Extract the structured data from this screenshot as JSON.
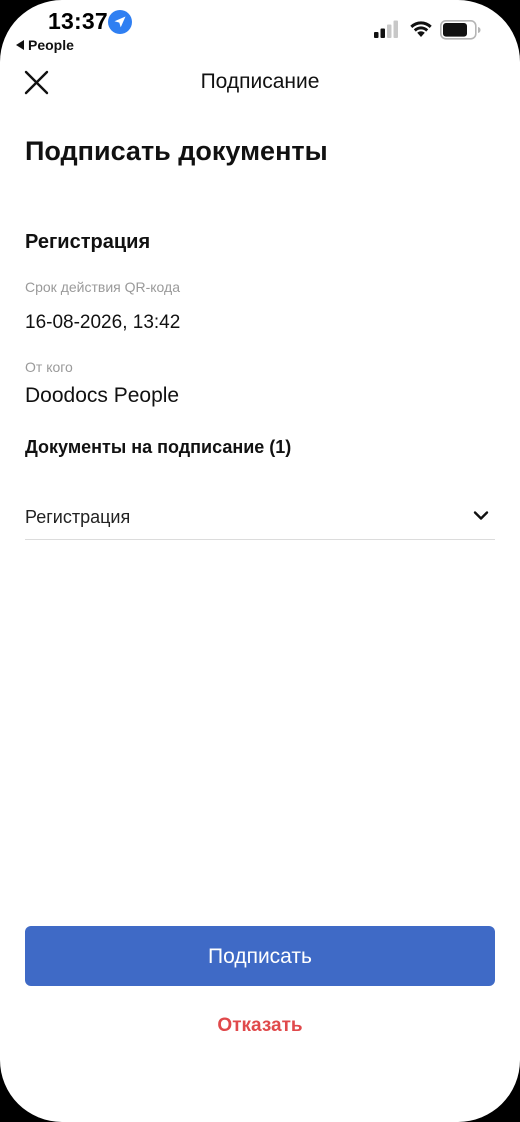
{
  "status_bar": {
    "time": "13:37",
    "back_app": "People",
    "location_icon": "location-arrow-icon",
    "signal_icon": "cellular-signal-icon",
    "wifi_icon": "wifi-icon",
    "battery_icon": "battery-icon"
  },
  "nav": {
    "title": "Подписание",
    "close_icon": "close-icon"
  },
  "page": {
    "title": "Подписать документы",
    "section_title": "Регистрация",
    "fields": [
      {
        "label": "Срок действия QR-кода",
        "value": "16-08-2026, 13:42"
      },
      {
        "label": "От кого",
        "value": "Doodocs People"
      }
    ],
    "documents_title": "Документы на подписание (1)",
    "documents": [
      {
        "name": "Регистрация"
      }
    ]
  },
  "actions": {
    "sign_label": "Подписать",
    "decline_label": "Отказать"
  },
  "colors": {
    "primary": "#3f6ac6",
    "danger": "#e0494b",
    "label_gray": "#9a9a9a"
  }
}
